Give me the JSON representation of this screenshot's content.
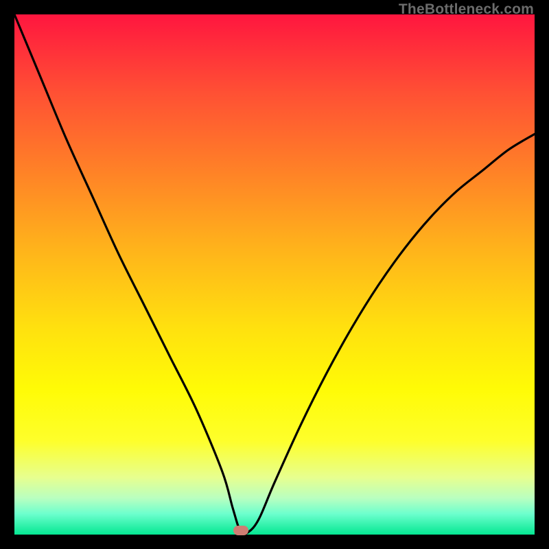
{
  "watermark": "TheBottleneck.com",
  "marker": {
    "x_frac": 0.435,
    "y_frac": 0.992
  },
  "chart_data": {
    "type": "line",
    "title": "",
    "xlabel": "",
    "ylabel": "",
    "xlim": [
      0,
      100
    ],
    "ylim": [
      0,
      100
    ],
    "x": [
      0,
      5,
      10,
      15,
      20,
      25,
      30,
      35,
      40,
      42,
      43.5,
      45,
      47,
      50,
      55,
      60,
      65,
      70,
      75,
      80,
      85,
      90,
      95,
      100
    ],
    "values": [
      100,
      88,
      76,
      65,
      54,
      44,
      34,
      24,
      12,
      5,
      0.5,
      0.5,
      3,
      10,
      21,
      31,
      40,
      48,
      55,
      61,
      66,
      70,
      74,
      77
    ],
    "marker_point": {
      "x": 43.5,
      "y": 0.8
    },
    "background_gradient": {
      "top": "#ff163f",
      "bottom": "#04e792",
      "description": "vertical red-to-green gradient (top=bad, bottom=good)"
    }
  }
}
